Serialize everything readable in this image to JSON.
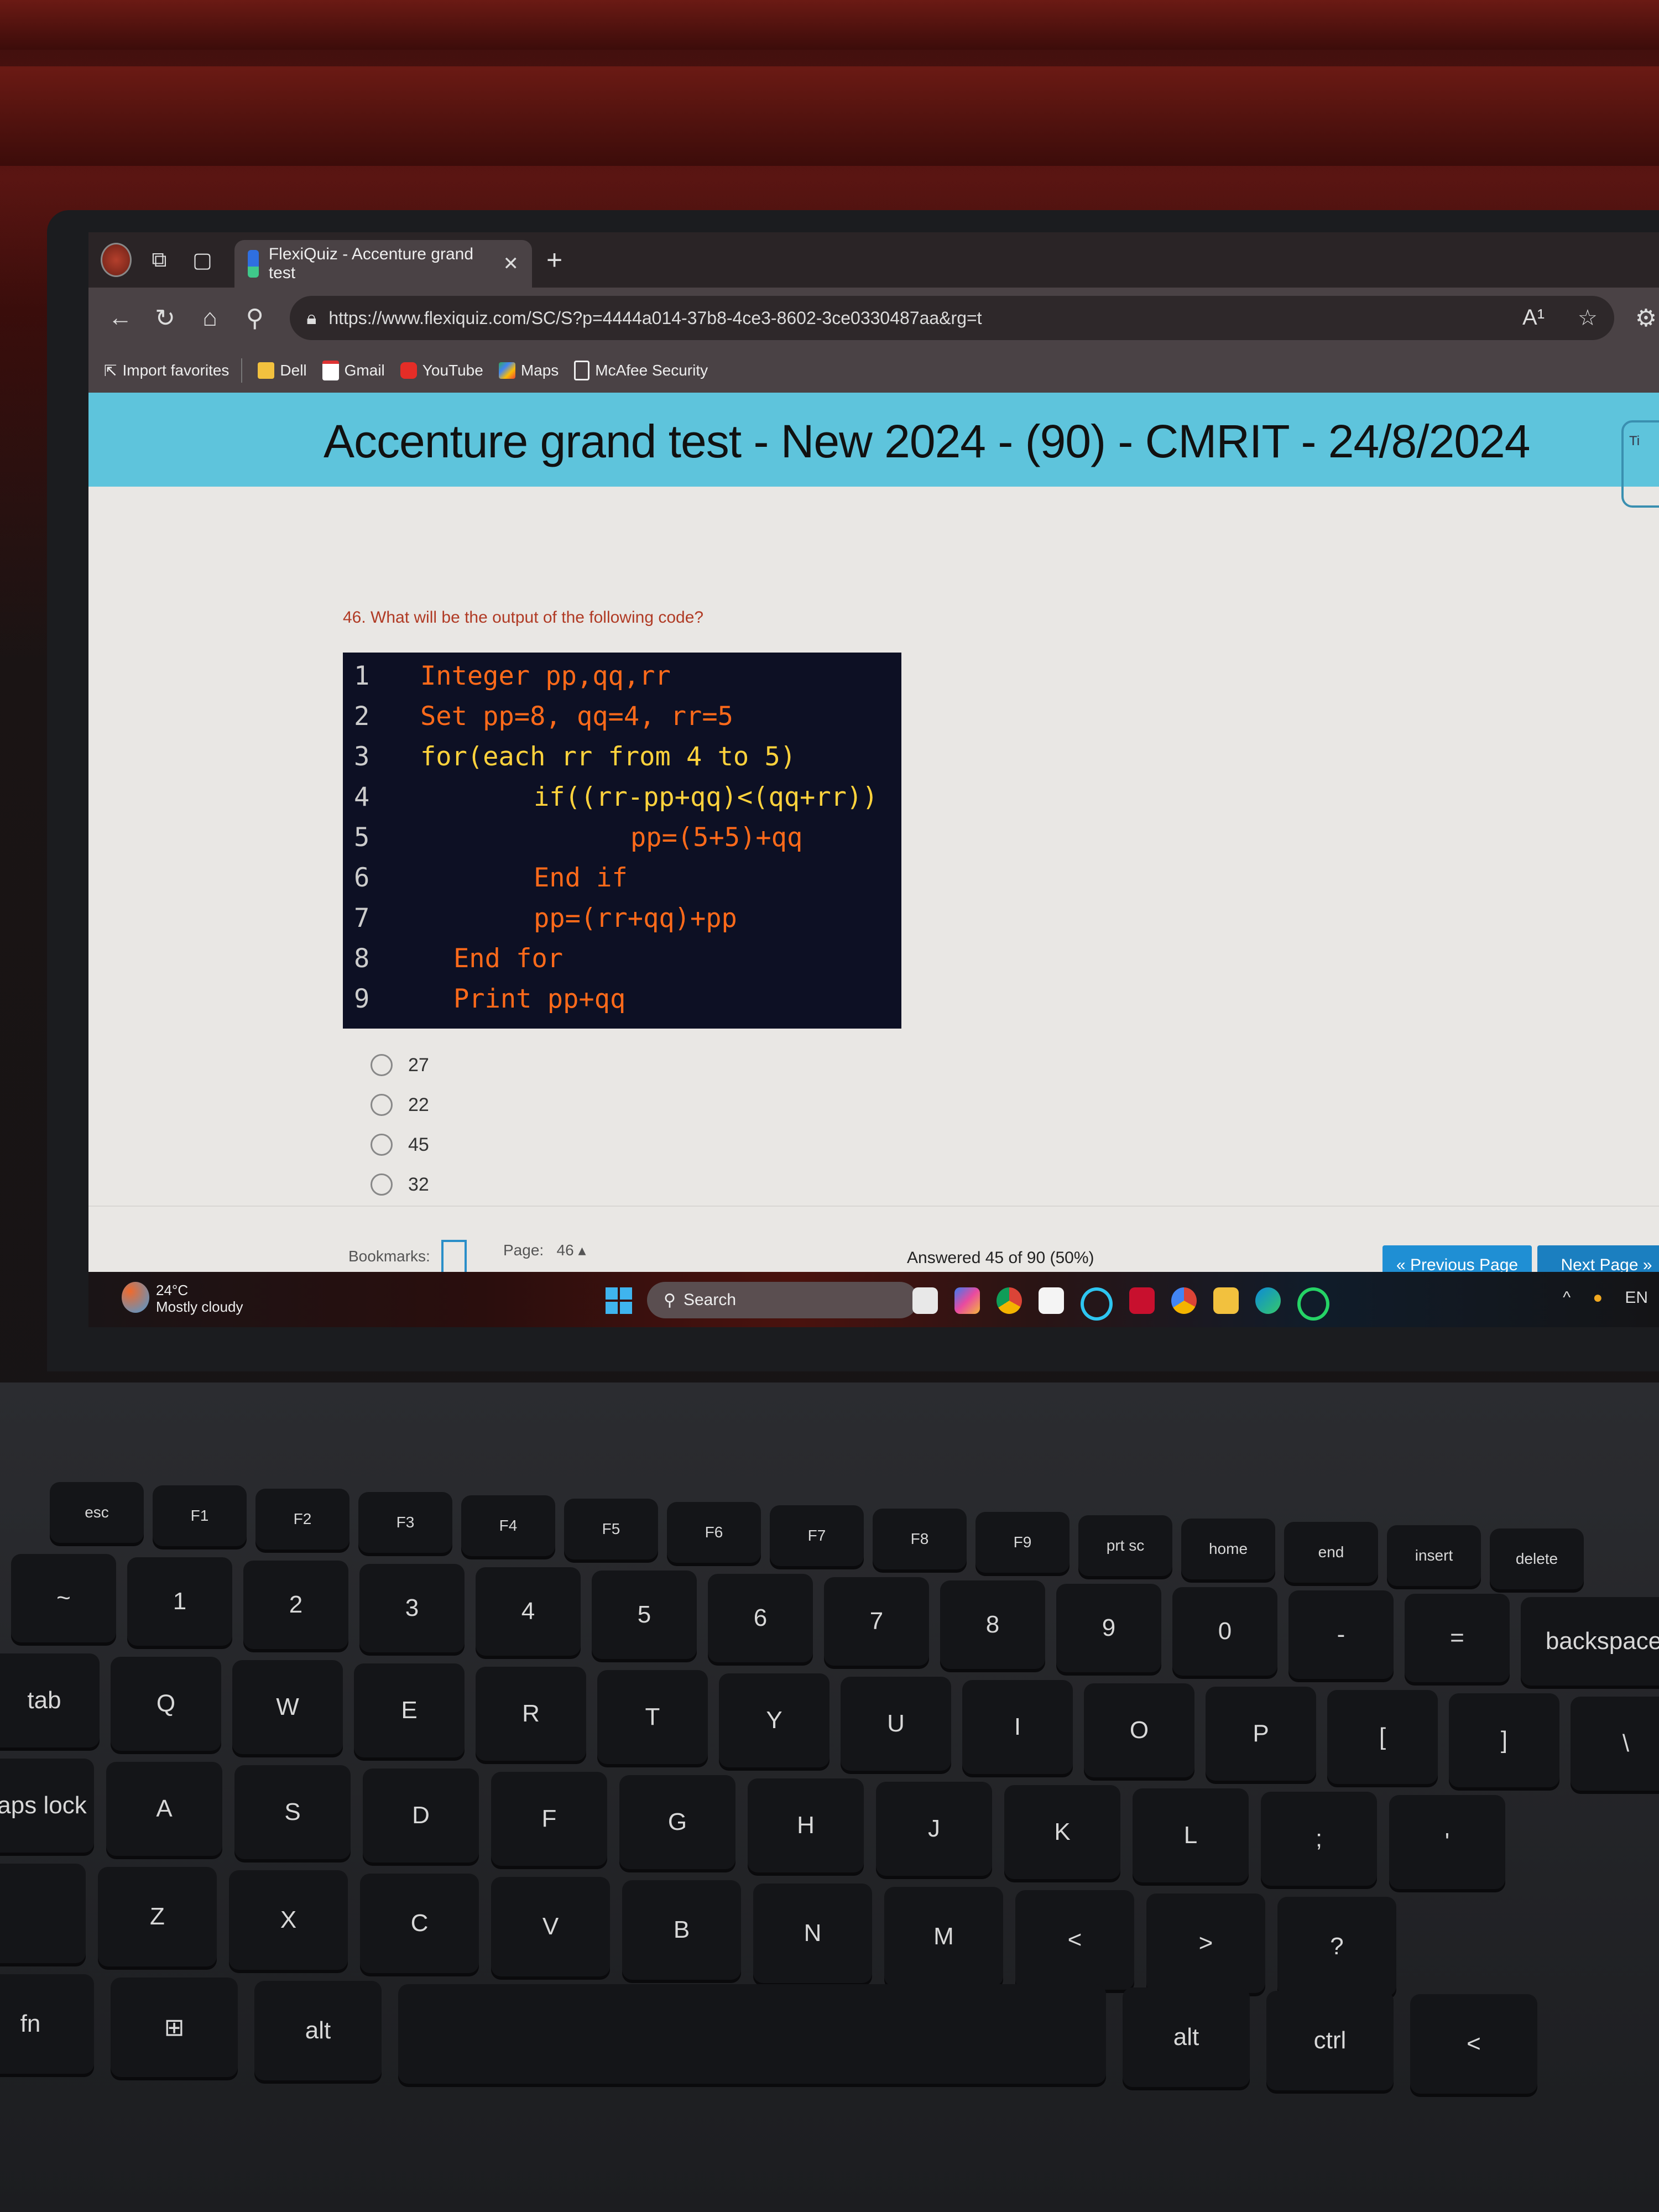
{
  "browser": {
    "tab_title": "FlexiQuiz - Accenture grand test",
    "url": "https://www.flexiquiz.com/SC/S?p=4444a014-37b8-4ce3-8602-3ce0330487aa&rg=t",
    "bookmarks": [
      "Import favorites",
      "Dell",
      "Gmail",
      "YouTube",
      "Maps",
      "McAfee Security"
    ],
    "icons": {
      "read_aloud": "A¹",
      "favorite": "☆",
      "extensions": "⚙"
    }
  },
  "quiz": {
    "title": "Accenture grand test - New 2024 - (90) - CMRIT - 24/8/2024",
    "timer_label": "Ti",
    "question": "46. What will be the output of the following code?",
    "code_lines": [
      {
        "n": "1",
        "text": "Integer pp,qq,rr"
      },
      {
        "n": "2",
        "text": "Set pp=8, qq=4, rr=5"
      },
      {
        "n": "3",
        "text": "for(each rr from 4 to 5)"
      },
      {
        "n": "4",
        "text": "if((rr-pp+qq)<(qq+rr))"
      },
      {
        "n": "5",
        "text": "pp=(5+5)+qq"
      },
      {
        "n": "6",
        "text": "End if"
      },
      {
        "n": "7",
        "text": "pp=(rr+qq)+pp"
      },
      {
        "n": "8",
        "text": "End for"
      },
      {
        "n": "9",
        "text": "Print pp+qq"
      }
    ],
    "options": [
      "27",
      "22",
      "45",
      "32"
    ],
    "footer": {
      "bookmarks_label": "Bookmarks:",
      "page_label": "Page:",
      "page_value": "46",
      "answered": "Answered 45 of 90 (50%)",
      "prev_label": "« Previous Page",
      "next_label": "Next Page »"
    }
  },
  "taskbar": {
    "temperature": "24°C",
    "weather": "Mostly cloudy",
    "search_label": "Search",
    "language": "EN"
  },
  "keyboard": {
    "fn_row": [
      "esc",
      "F1",
      "F2",
      "F3",
      "F4",
      "F5",
      "F6",
      "F7",
      "F8",
      "F9",
      "prt sc",
      "home",
      "end",
      "insert",
      "delete"
    ],
    "num_row": [
      "~",
      "1",
      "2",
      "3",
      "4",
      "5",
      "6",
      "7",
      "8",
      "9",
      "0",
      "-",
      "=",
      "backspace"
    ],
    "row_q": [
      "tab",
      "Q",
      "W",
      "E",
      "R",
      "T",
      "Y",
      "U",
      "I",
      "O",
      "P",
      "[",
      "]",
      "\\"
    ],
    "row_a": [
      "caps lock",
      "A",
      "S",
      "D",
      "F",
      "G",
      "H",
      "J",
      "K",
      "L",
      ";",
      "'"
    ],
    "row_z": [
      "",
      "Z",
      "X",
      "C",
      "V",
      "B",
      "N",
      "M",
      "<",
      ">",
      "?"
    ],
    "row_bottom": [
      "fn",
      "win",
      "alt",
      "",
      "alt",
      "ctrl",
      "<"
    ]
  },
  "colors": {
    "banner": "#5ec4dc",
    "button": "#1f8fd4",
    "question_text": "#b03a24",
    "code_bg": "#0d1024"
  }
}
